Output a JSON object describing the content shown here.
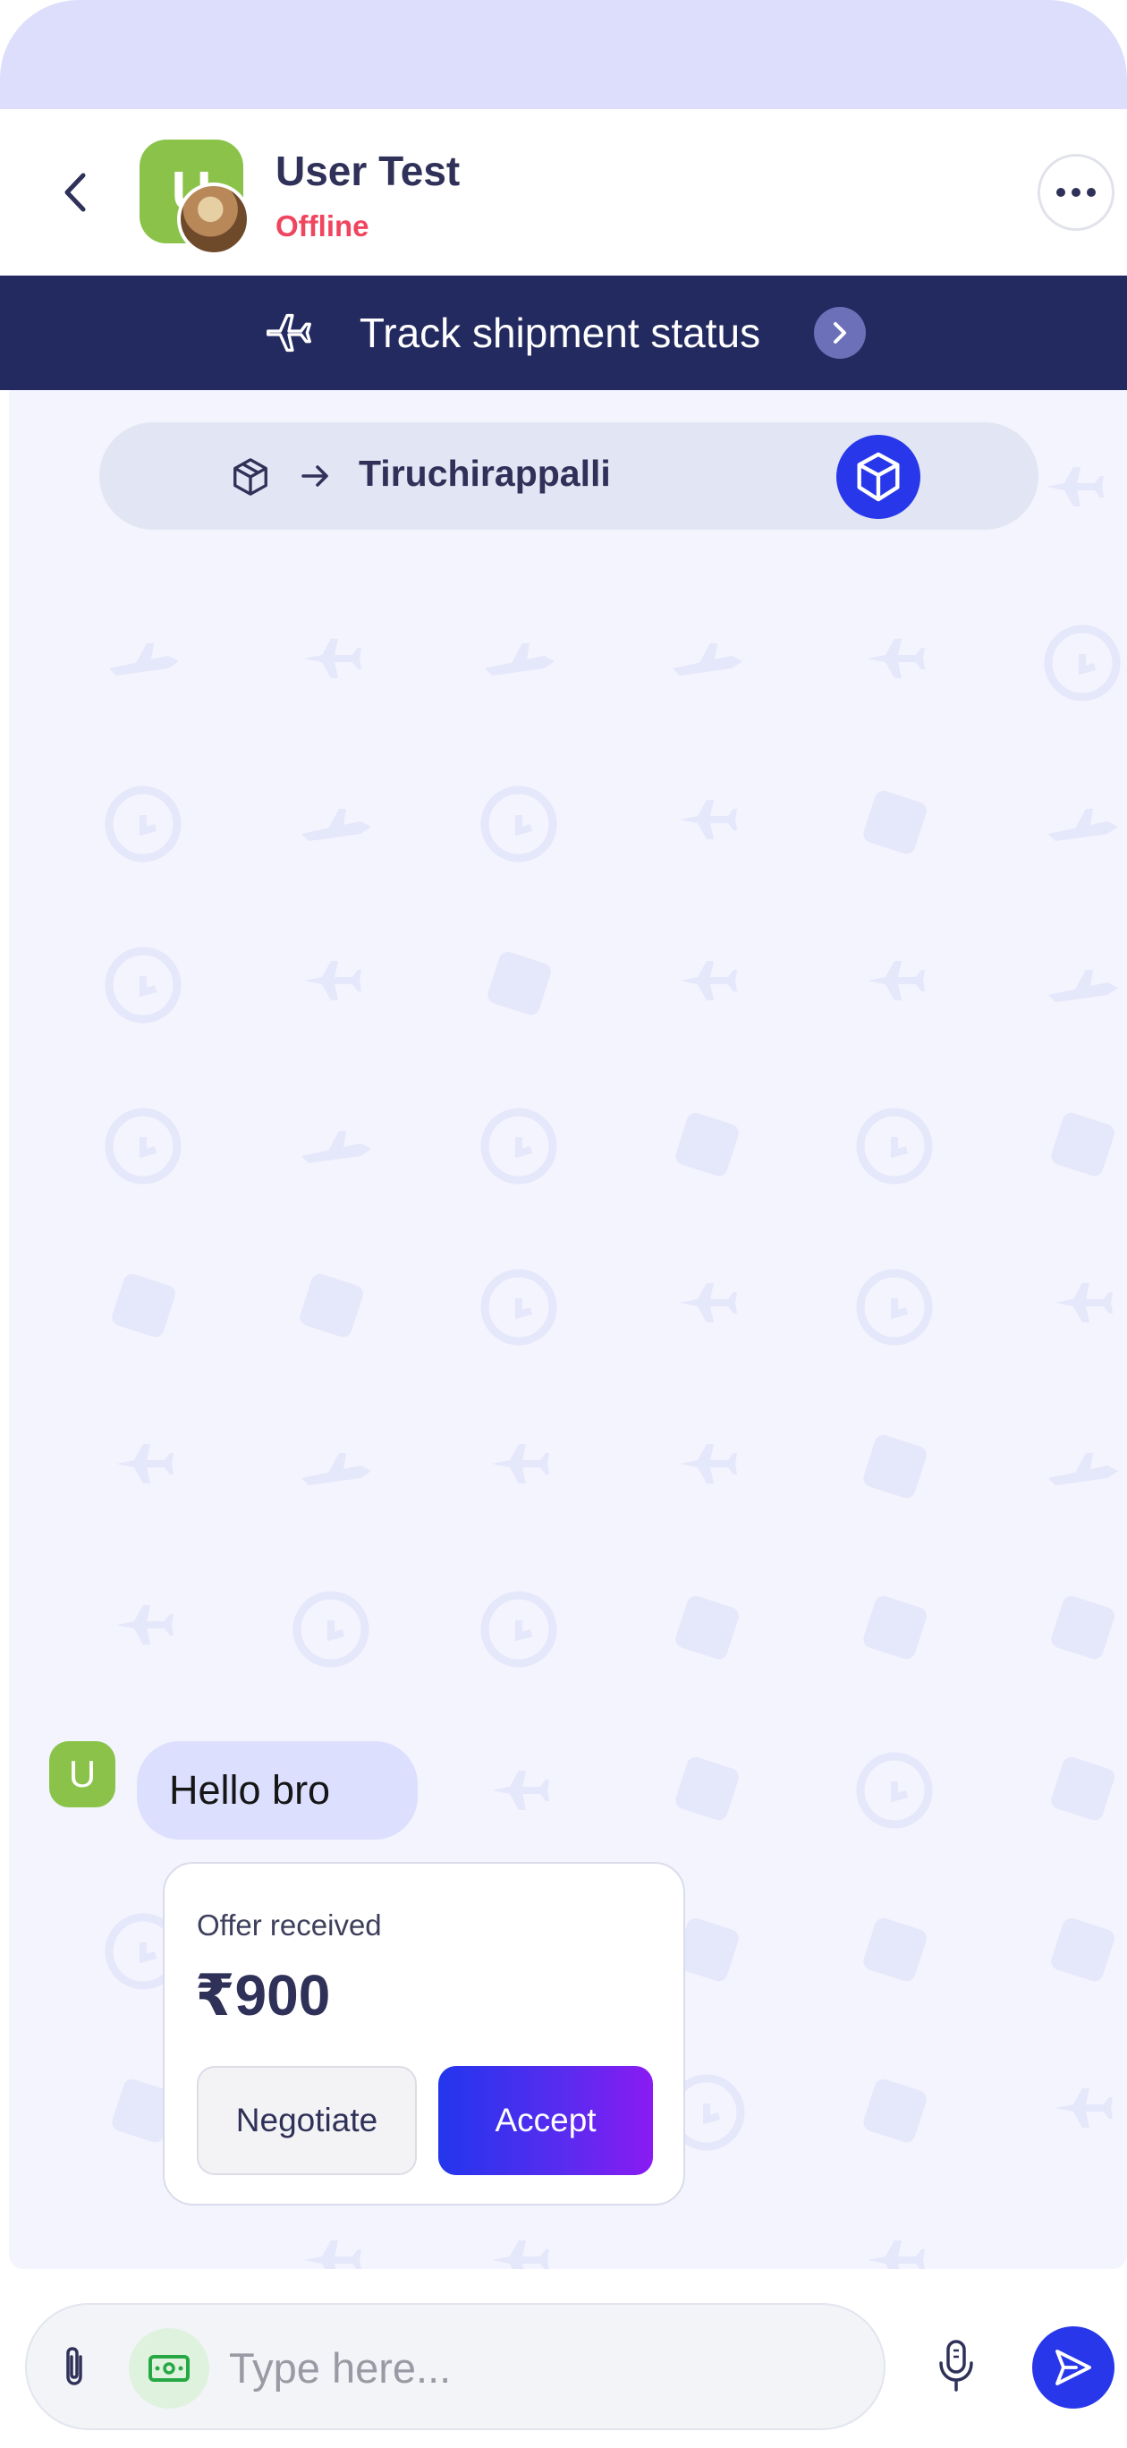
{
  "colors": {
    "navy": "#222a60",
    "accent_blue": "#2837ea",
    "status_offline": "#f0455f",
    "avatar_green": "#8bc34a",
    "chat_background": "#f3f4fe",
    "incoming_bubble": "#dcdffd",
    "accept_gradient": [
      "#2236ec",
      "#8a1bf2"
    ]
  },
  "header": {
    "back_icon": "chevron-left-icon",
    "contact": {
      "avatar_initial": "U",
      "name": "User Test",
      "status": "Offline"
    },
    "menu_icon": "more-dots-icon"
  },
  "track_banner": {
    "icon": "airplane-icon",
    "label": "Track shipment status",
    "chevron_icon": "chevron-right-icon"
  },
  "route": {
    "origin_icon": "package-icon",
    "arrow_icon": "arrow-right-icon",
    "destination": "Tiruchirappalli",
    "action_icon": "cube-icon"
  },
  "messages": [
    {
      "avatar_initial": "U",
      "text": "Hello bro"
    }
  ],
  "offer": {
    "label": "Offer received",
    "amount": "₹900",
    "negotiate_label": "Negotiate",
    "accept_label": "Accept"
  },
  "composer": {
    "attach_icon": "paperclip-icon",
    "money_icon": "banknote-icon",
    "placeholder": "Type here...",
    "mic_icon": "microphone-icon",
    "send_icon": "send-icon"
  }
}
